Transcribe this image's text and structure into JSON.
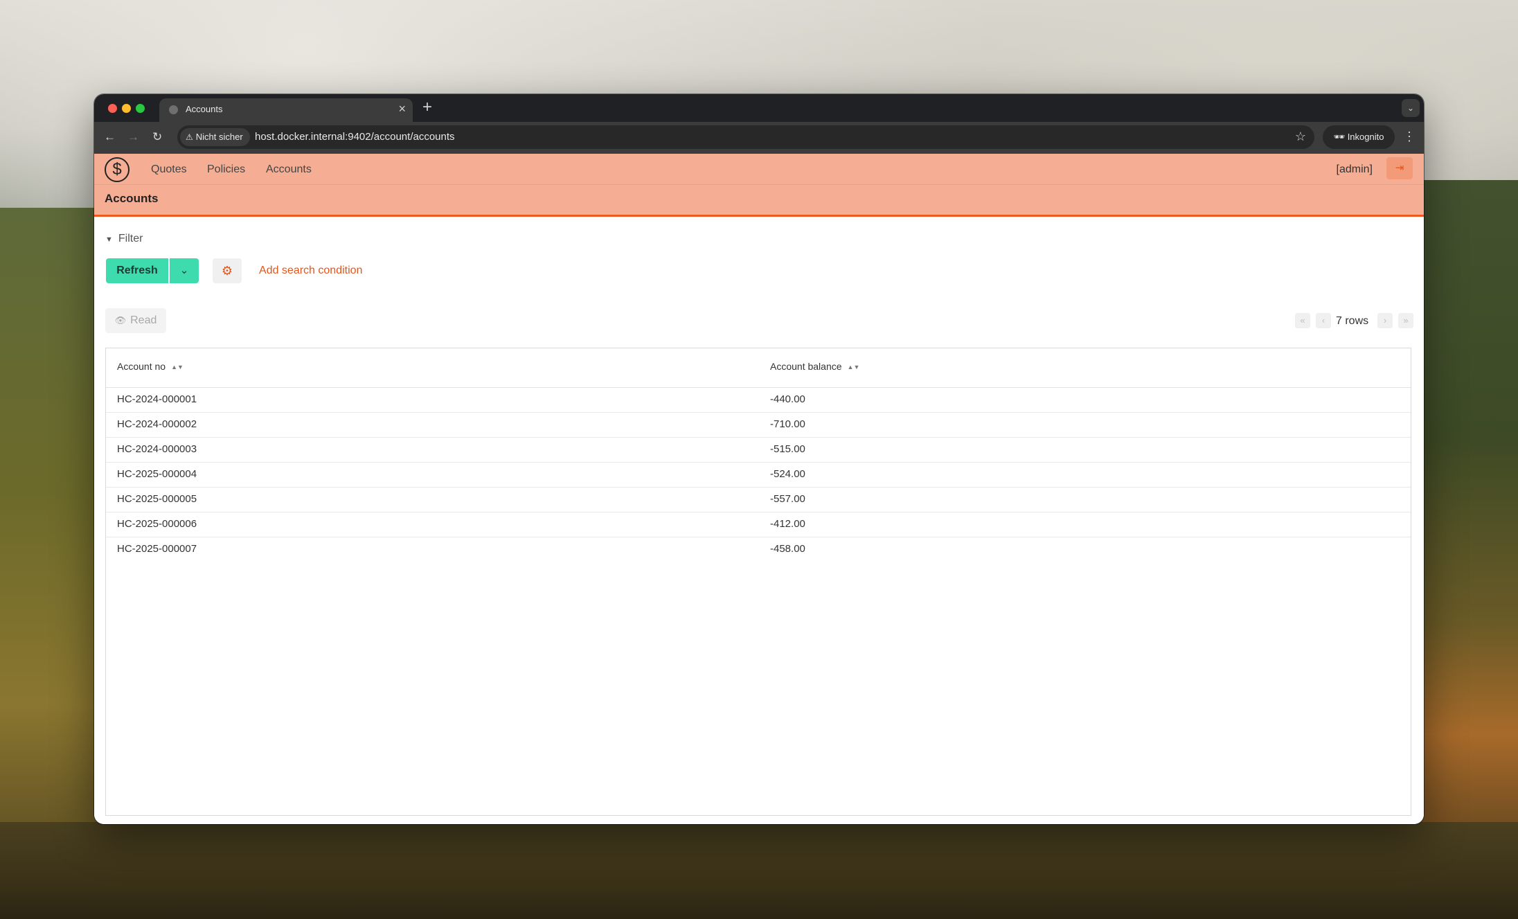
{
  "browser": {
    "tab_title": "Accounts",
    "security_label": "Nicht sicher",
    "url": "host.docker.internal:9402/account/accounts",
    "incognito_label": "Inkognito"
  },
  "app": {
    "logo_symbol": "$",
    "menu": [
      "Quotes",
      "Policies",
      "Accounts"
    ],
    "user_label": "[admin]",
    "page_title": "Accounts"
  },
  "filter": {
    "toggle_label": "Filter",
    "refresh_label": "Refresh",
    "add_search_label": "Add search condition"
  },
  "actions": {
    "read_label": "Read"
  },
  "pager": {
    "row_count": "7 rows"
  },
  "table": {
    "columns": [
      "Account no",
      "Account balance"
    ],
    "rows": [
      [
        "HC-2024-000001",
        "-440.00"
      ],
      [
        "HC-2024-000002",
        "-710.00"
      ],
      [
        "HC-2024-000003",
        "-515.00"
      ],
      [
        "HC-2025-000004",
        "-524.00"
      ],
      [
        "HC-2025-000005",
        "-557.00"
      ],
      [
        "HC-2025-000006",
        "-412.00"
      ],
      [
        "HC-2025-000007",
        "-458.00"
      ]
    ]
  },
  "colors": {
    "appbar": "#f5ae94",
    "accent": "#ee5a20",
    "primary_button": "#3ddbae"
  },
  "icons": {
    "back": "arrow-left-icon",
    "forward": "arrow-right-icon",
    "reload": "reload-icon",
    "warning": "warning-icon",
    "bookmark": "star-icon",
    "incognito": "incognito-icon",
    "logout": "logout-icon",
    "settings": "gear-icon",
    "read": "eye-icon",
    "sort": "sort-icon"
  }
}
